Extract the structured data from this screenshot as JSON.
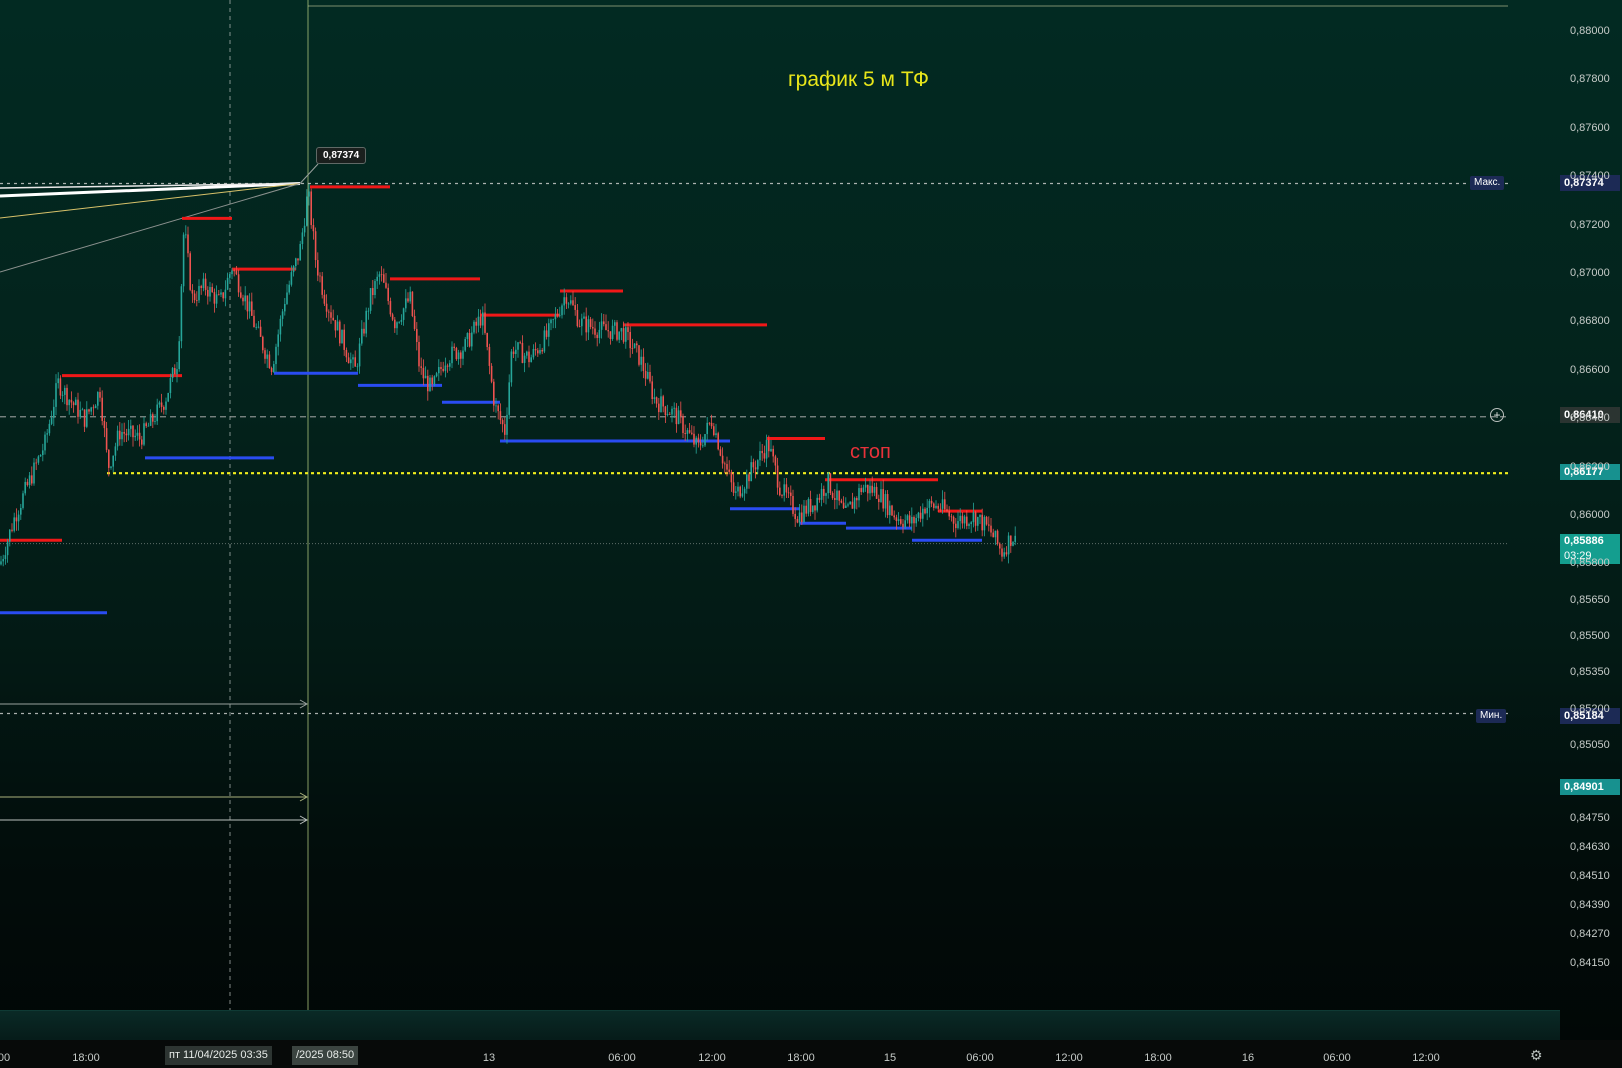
{
  "chart_data": {
    "type": "candlestick",
    "title": "график 5 м ТФ",
    "annotation_stop": "стоп",
    "y_ticks": [
      "0,88000",
      "0,87800",
      "0,87600",
      "0,87400",
      "0,87200",
      "0,87000",
      "0,86800",
      "0,86600",
      "0,86400",
      "0,86200",
      "0,86000",
      "0,85800",
      "0,85650",
      "0,85500",
      "0,85350",
      "0,85200",
      "0,85050",
      "0,84750",
      "0,84630",
      "0,84510",
      "0,84390",
      "0,84270",
      "0,84150"
    ],
    "y_tick_values": [
      0.88,
      0.878,
      0.876,
      0.874,
      0.872,
      0.87,
      0.868,
      0.866,
      0.864,
      0.862,
      0.86,
      0.858,
      0.8565,
      0.855,
      0.8535,
      0.852,
      0.8505,
      0.8475,
      0.8463,
      0.8451,
      0.8439,
      0.8427,
      0.8415
    ],
    "x_ticks": [
      "00",
      "18:00",
      "13",
      "06:00",
      "12:00",
      "18:00",
      "15",
      "06:00",
      "12:00",
      "18:00",
      "16",
      "06:00",
      "12:00"
    ],
    "crosshair_time": "пт 11/04/2025   03:35",
    "crosshair_time2": "/2025   08:50",
    "max_label": "Макс.",
    "max_value": "0,87374",
    "min_label": "Мин.",
    "min_value": "0,85184",
    "crosshair_price": "0,86410",
    "yellow_level": "0,86177",
    "current_price": "0,85886",
    "countdown": "03:29",
    "extra_level": "0,84901",
    "callout_value": "0,87374",
    "grid": false,
    "resistance_levels": [
      {
        "from": 0,
        "to": 62,
        "y": 0.859
      },
      {
        "from": 182,
        "to": 232,
        "y": 0.8723
      },
      {
        "from": 232,
        "to": 296,
        "y": 0.8702
      },
      {
        "from": 310,
        "to": 390,
        "y": 0.8736
      },
      {
        "from": 62,
        "to": 182,
        "y": 0.8658
      },
      {
        "from": 390,
        "to": 480,
        "y": 0.8698
      },
      {
        "from": 480,
        "to": 560,
        "y": 0.8683
      },
      {
        "from": 560,
        "to": 623,
        "y": 0.8693
      },
      {
        "from": 623,
        "to": 767,
        "y": 0.8679
      },
      {
        "from": 767,
        "to": 825,
        "y": 0.8632
      },
      {
        "from": 825,
        "to": 938,
        "y": 0.8615
      },
      {
        "from": 938,
        "to": 982,
        "y": 0.8602
      }
    ],
    "support_levels": [
      {
        "from": 0,
        "to": 107,
        "y": 0.856
      },
      {
        "from": 145,
        "to": 274,
        "y": 0.8624
      },
      {
        "from": 274,
        "to": 358,
        "y": 0.8659
      },
      {
        "from": 358,
        "to": 442,
        "y": 0.8654
      },
      {
        "from": 442,
        "to": 500,
        "y": 0.8647
      },
      {
        "from": 500,
        "to": 730,
        "y": 0.8631
      },
      {
        "from": 730,
        "to": 800,
        "y": 0.8603
      },
      {
        "from": 800,
        "to": 846,
        "y": 0.8597
      },
      {
        "from": 846,
        "to": 912,
        "y": 0.8595
      },
      {
        "from": 912,
        "to": 982,
        "y": 0.859
      }
    ],
    "price_path": [
      [
        0,
        0.858
      ],
      [
        15,
        0.86
      ],
      [
        30,
        0.8615
      ],
      [
        45,
        0.863
      ],
      [
        58,
        0.8655
      ],
      [
        70,
        0.8648
      ],
      [
        85,
        0.864
      ],
      [
        100,
        0.8652
      ],
      [
        108,
        0.862
      ],
      [
        120,
        0.8635
      ],
      [
        140,
        0.8632
      ],
      [
        150,
        0.8638
      ],
      [
        165,
        0.8648
      ],
      [
        178,
        0.8665
      ],
      [
        184,
        0.872
      ],
      [
        192,
        0.869
      ],
      [
        205,
        0.8695
      ],
      [
        220,
        0.8688
      ],
      [
        232,
        0.8703
      ],
      [
        245,
        0.869
      ],
      [
        258,
        0.8675
      ],
      [
        272,
        0.8662
      ],
      [
        285,
        0.869
      ],
      [
        300,
        0.871
      ],
      [
        308,
        0.8734
      ],
      [
        316,
        0.8705
      ],
      [
        325,
        0.869
      ],
      [
        340,
        0.8675
      ],
      [
        355,
        0.866
      ],
      [
        370,
        0.869
      ],
      [
        380,
        0.87
      ],
      [
        395,
        0.868
      ],
      [
        410,
        0.869
      ],
      [
        420,
        0.866
      ],
      [
        432,
        0.8652
      ],
      [
        445,
        0.8665
      ],
      [
        465,
        0.867
      ],
      [
        482,
        0.8683
      ],
      [
        495,
        0.8645
      ],
      [
        505,
        0.8635
      ],
      [
        512,
        0.867
      ],
      [
        530,
        0.8665
      ],
      [
        548,
        0.8675
      ],
      [
        566,
        0.8692
      ],
      [
        580,
        0.868
      ],
      [
        600,
        0.8677
      ],
      [
        623,
        0.8676
      ],
      [
        640,
        0.8665
      ],
      [
        655,
        0.8648
      ],
      [
        675,
        0.8642
      ],
      [
        698,
        0.8628
      ],
      [
        712,
        0.864
      ],
      [
        722,
        0.8625
      ],
      [
        735,
        0.8608
      ],
      [
        750,
        0.8618
      ],
      [
        768,
        0.863
      ],
      [
        780,
        0.8612
      ],
      [
        798,
        0.86
      ],
      [
        815,
        0.8606
      ],
      [
        828,
        0.8614
      ],
      [
        845,
        0.86
      ],
      [
        862,
        0.8612
      ],
      [
        878,
        0.861
      ],
      [
        895,
        0.86
      ],
      [
        912,
        0.8597
      ],
      [
        925,
        0.8604
      ],
      [
        940,
        0.8604
      ],
      [
        955,
        0.8598
      ],
      [
        975,
        0.86
      ],
      [
        990,
        0.8594
      ],
      [
        1002,
        0.8585
      ],
      [
        1012,
        0.8592
      ],
      [
        1016,
        0.8589
      ]
    ]
  }
}
